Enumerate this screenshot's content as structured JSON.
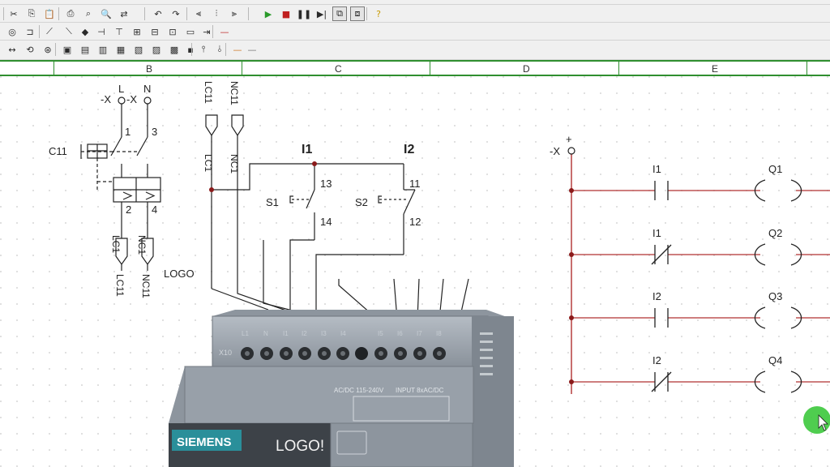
{
  "ruler": {
    "columns": [
      "B",
      "C",
      "D",
      "E"
    ]
  },
  "toolbar": {
    "row1": [
      "cut-icon",
      "copy-icon",
      "paste-icon",
      "print-icon",
      "print-preview-icon",
      "find-icon",
      "replace-icon",
      "undo-icon",
      "redo-icon",
      "align-left-icon",
      "align-center-icon",
      "align-right-icon",
      "run-icon",
      "stop-icon",
      "pause-icon",
      "step-icon",
      "monitor-icon",
      "monitor-edit-icon",
      "help-icon"
    ],
    "row2": [
      "coil-icon",
      "switch-icon",
      "contact-no-icon",
      "contact-nc-icon",
      "junction-icon",
      "plug-icon",
      "connector-icon",
      "socket-icon",
      "relay-icon",
      "breaker-icon",
      "terminal-icon",
      "bus-icon",
      "wire-icon"
    ],
    "row3": [
      "arrows-icon",
      "rotate-icon",
      "sensor-icon",
      "block-a-icon",
      "block-b-icon",
      "block-c-icon",
      "block-d-icon",
      "block-e-icon",
      "block-f-icon",
      "block-g-icon",
      "block-h-icon",
      "vertical-pin-icon",
      "vertical-drop-icon",
      "line-orange-icon",
      "line-gray-icon"
    ]
  },
  "left_circuit": {
    "supply_prefix": "-X",
    "supply_terminals": [
      "L",
      "N"
    ],
    "breaker_label": "C11",
    "in_terminals": [
      "1",
      "3"
    ],
    "out_terminals": [
      "2",
      "4"
    ],
    "out_connectors": [
      "LC1",
      "NC1"
    ],
    "out_labels": [
      "LC11",
      "NC11"
    ],
    "logo_label": "LOGO"
  },
  "input_circuit": {
    "top_connectors": [
      "LC11",
      "NC11"
    ],
    "wire_labels": [
      "LC1",
      "NC1"
    ],
    "inputs": [
      {
        "name": "I1",
        "switch": "S1",
        "top": "13",
        "bottom": "14"
      },
      {
        "name": "I2",
        "switch": "S2",
        "top": "11",
        "bottom": "12"
      }
    ]
  },
  "logo_module": {
    "brand": "SIEMENS",
    "model": "LOGO!",
    "power_label": "AC/DC  115-240V",
    "input_label": "INPUT 8xAC/DC",
    "block_label": "X10",
    "terminals": [
      "L1",
      "N",
      "I1",
      "I2",
      "I3",
      "I4",
      "I5",
      "I6",
      "I7",
      "I8"
    ]
  },
  "ladder": {
    "supply_prefix": "-X",
    "supply_sign": "+",
    "rungs": [
      {
        "contact": "I1",
        "type": "NO",
        "coil": "Q1"
      },
      {
        "contact": "I1",
        "type": "NC",
        "coil": "Q2"
      },
      {
        "contact": "I2",
        "type": "NO",
        "coil": "Q3"
      },
      {
        "contact": "I2",
        "type": "NC",
        "coil": "Q4"
      }
    ]
  },
  "colors": {
    "wire": "#222222",
    "power_rail": "#b03030",
    "junction": "#8b1a1a",
    "cursor_highlight": "#3cc83c",
    "ruler": "#2f8f2f",
    "module": "#9aa2ab",
    "siemens_teal": "#2a8f9a"
  }
}
